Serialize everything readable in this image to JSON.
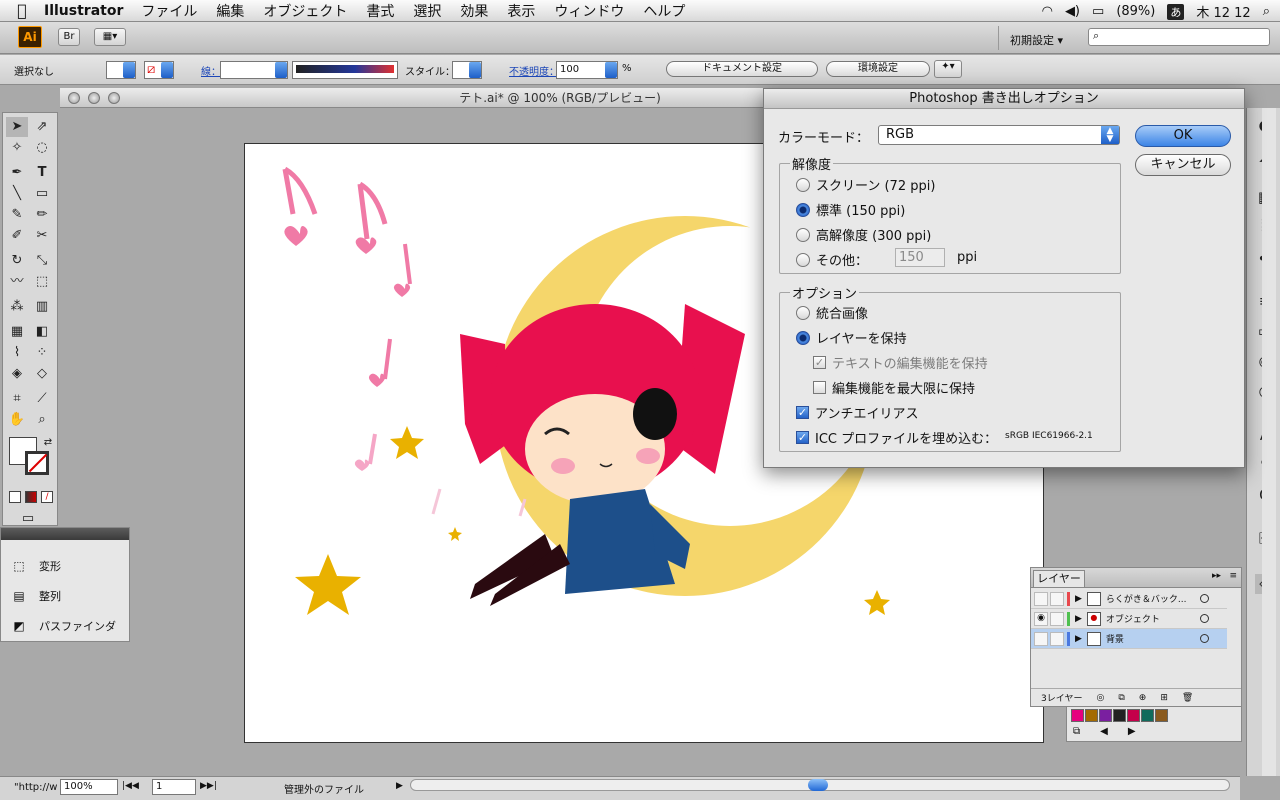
{
  "menubar": {
    "app_name": "Illustrator",
    "items": [
      "ファイル",
      "編集",
      "オブジェクト",
      "書式",
      "選択",
      "効果",
      "表示",
      "ウィンドウ",
      "ヘルプ"
    ],
    "battery": "(89%)",
    "input_method": "あ",
    "clock": "木 12 12"
  },
  "app_toolbar": {
    "ai_logo": "Ai",
    "bridge_label": "Br",
    "workspace": "初期設定"
  },
  "control_bar": {
    "selection": "選択なし",
    "stroke_label": "線：",
    "style_label": "スタイル：",
    "opacity_label": "不透明度：",
    "opacity_value": "100",
    "percent": "%",
    "doc_settings_button": "ドキュメント設定",
    "prefs_button": "環境設定"
  },
  "document": {
    "title": "テト.ai* @ 100% (RGB/プレビュー)"
  },
  "transform_panel": {
    "items": [
      "変形",
      "整列",
      "パスファインダ"
    ]
  },
  "dialog": {
    "title": "Photoshop 書き出しオプション",
    "color_mode_label": "カラーモード：",
    "color_mode_value": "RGB",
    "ok_button": "OK",
    "cancel_button": "キャンセル",
    "resolution_group": "解像度",
    "resolution_options": [
      "スクリーン (72 ppi)",
      "標準 (150 ppi)",
      "高解像度 (300 ppi)",
      "その他："
    ],
    "selected_resolution": "標準 (150 ppi)",
    "other_ppi_value": "150",
    "ppi_unit": "ppi",
    "options_group": "オプション",
    "flatten_label": "統合画像",
    "keep_layers_label": "レイヤーを保持",
    "keep_text_label": "テキストの編集機能を保持",
    "max_edit_label": "編集機能を最大限に保持",
    "antialias_label": "アンチエイリアス",
    "icc_label": "ICC プロファイルを埋め込む：",
    "icc_value": "sRGB IEC61966-2.1"
  },
  "layers_panel": {
    "tab": "レイヤー",
    "layers": [
      {
        "name": "らくがき＆バック...",
        "color": "#e8484d",
        "visible": false
      },
      {
        "name": "オブジェクト",
        "color": "#4fc04f",
        "visible": true
      },
      {
        "name": "背景",
        "color": "#4a78e0",
        "visible": false
      }
    ],
    "count": "3レイヤー"
  },
  "status_bar": {
    "url": "\"http://w",
    "zoom": "100%",
    "page": "1",
    "status": "管理外のファイル"
  },
  "swatch_colors": [
    "#e6007e",
    "#a36b00",
    "#7a1fa0",
    "#222222",
    "#c4004a",
    "#106b5c",
    "#8a5a1e"
  ]
}
